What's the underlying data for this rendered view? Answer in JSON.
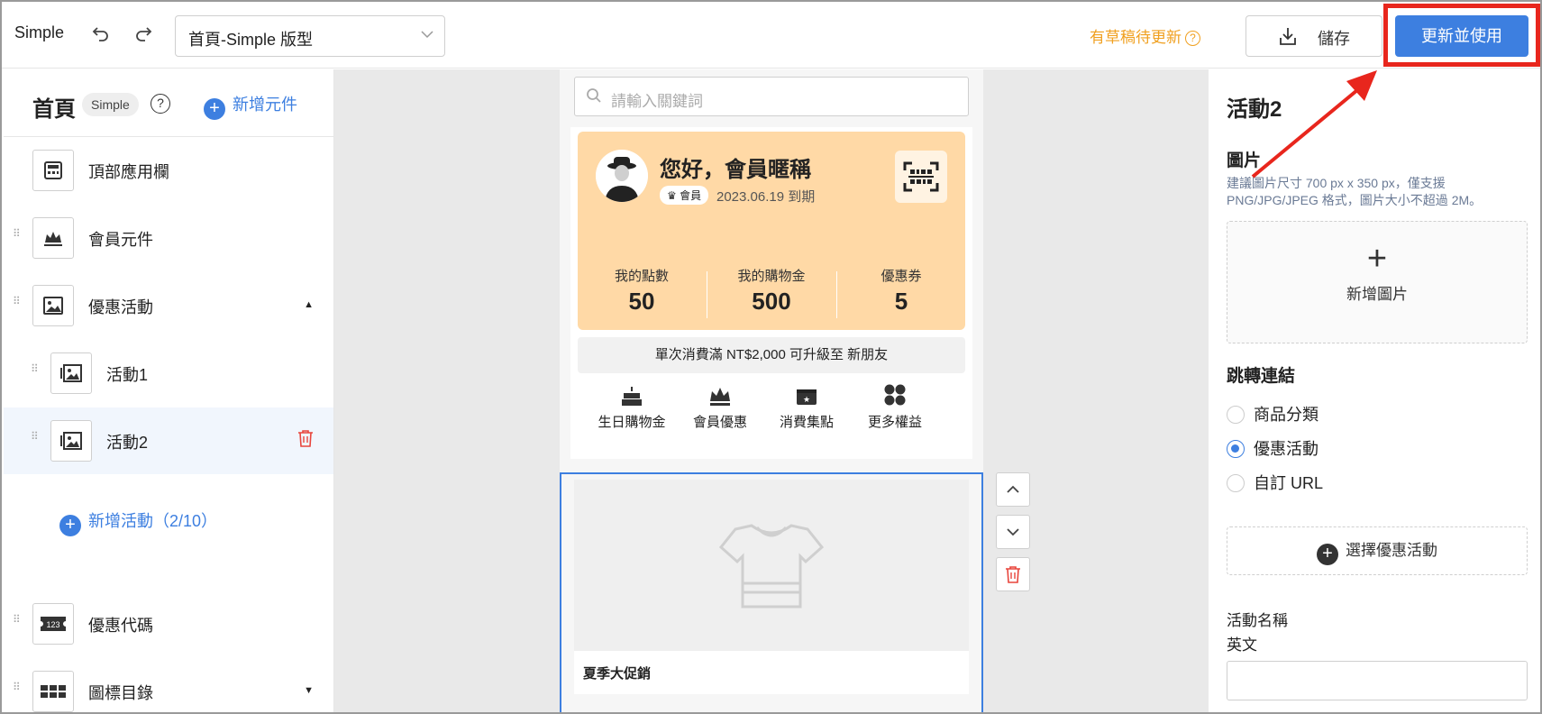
{
  "topbar": {
    "app_name": "Simple",
    "page_select": "首頁-Simple 版型",
    "draft_notice": "有草稿待更新",
    "save_label": "儲存",
    "publish_label": "更新並使用"
  },
  "sidebar": {
    "title": "首頁",
    "badge": "Simple",
    "add_component": "新增元件",
    "items": [
      {
        "label": "頂部應用欄",
        "icon": "app-bar-icon"
      },
      {
        "label": "會員元件",
        "icon": "crown-icon"
      },
      {
        "label": "優惠活動",
        "icon": "image-icon",
        "expanded": true
      },
      {
        "label": "活動1",
        "icon": "gallery-icon"
      },
      {
        "label": "活動2",
        "icon": "gallery-icon",
        "selected": true
      },
      {
        "label": "優惠代碼",
        "icon": "coupon-code-icon"
      },
      {
        "label": "圖標目錄",
        "icon": "grid-icon",
        "expanded": false
      }
    ],
    "add_activity": "新增活動（2/10）"
  },
  "preview": {
    "search_placeholder": "請輸入關鍵詞",
    "greeting": "您好，會員暱稱",
    "member_badge": "會員",
    "expiry": "2023.06.19 到期",
    "stats": [
      {
        "label": "我的點數",
        "value": "50"
      },
      {
        "label": "我的購物金",
        "value": "500"
      },
      {
        "label": "優惠券",
        "value": "5"
      }
    ],
    "upgrade_text": "單次消費滿 NT$2,000 可升級至 新朋友",
    "perks": [
      {
        "label": "生日購物金",
        "icon": "cake-icon"
      },
      {
        "label": "會員優惠",
        "icon": "crown-icon"
      },
      {
        "label": "消費集點",
        "icon": "ticket-icon"
      },
      {
        "label": "更多權益",
        "icon": "clover-icon"
      }
    ],
    "promo_caption": "夏季大促銷"
  },
  "panel": {
    "title": "活動2",
    "image_section": "圖片",
    "image_hint": "建議圖片尺寸 700 px x 350 px，僅支援 PNG/JPG/JPEG 格式，圖片大小不超過 2M。",
    "add_image": "新增圖片",
    "link_section": "跳轉連結",
    "link_options": [
      "商品分類",
      "優惠活動",
      "自訂 URL"
    ],
    "link_selected": "優惠活動",
    "choose_activity": "選擇優惠活動",
    "activity_name_label": "活動名稱",
    "english_label": "英文",
    "english_value": ""
  },
  "colors": {
    "accent": "#3d7fe0",
    "highlight": "#e8261d",
    "draft": "#f0a020",
    "member_card": "#ffd9a6"
  }
}
